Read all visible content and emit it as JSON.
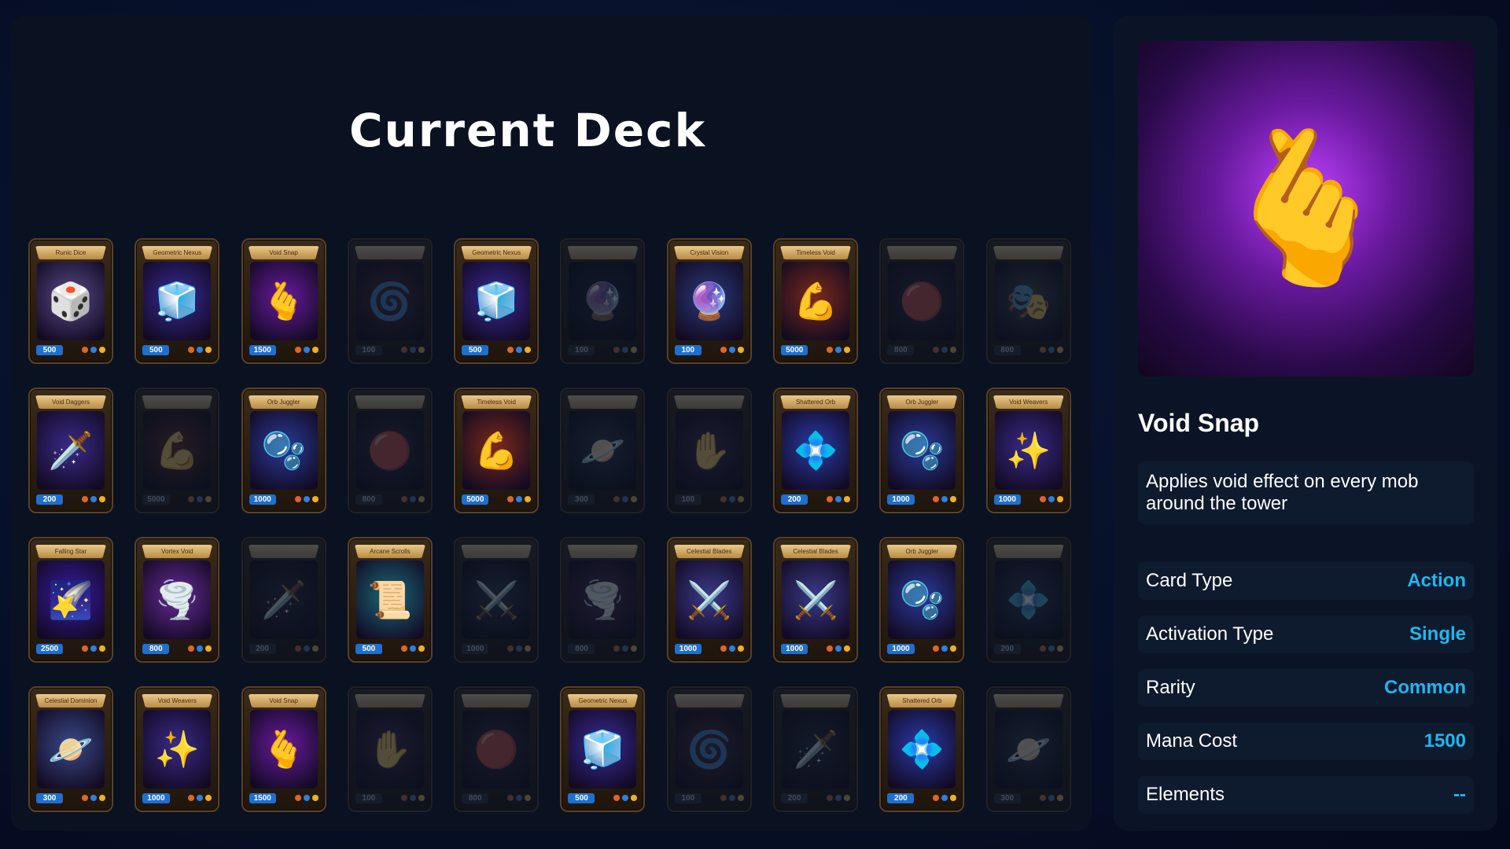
{
  "deck": {
    "title": "Current Deck",
    "cards": [
      {
        "name": "Runic Dice",
        "cost": "500",
        "icon": "dice-icon",
        "glyph": "🎲",
        "bg": "#5a4a8a",
        "active": true
      },
      {
        "name": "Geometric Nexus",
        "cost": "500",
        "icon": "cube-icon",
        "glyph": "🧊",
        "bg": "#3a2a9a",
        "active": true
      },
      {
        "name": "Void Snap",
        "cost": "1500",
        "icon": "snap-hand-icon",
        "glyph": "🫰",
        "bg": "#6a1aa0",
        "active": true
      },
      {
        "name": "",
        "cost": "100",
        "icon": "spiral-icon",
        "glyph": "🌀",
        "bg": "#5a2a3a",
        "active": false
      },
      {
        "name": "Geometric Nexus",
        "cost": "500",
        "icon": "cube-icon",
        "glyph": "🧊",
        "bg": "#3a2a9a",
        "active": true
      },
      {
        "name": "",
        "cost": "100",
        "icon": "crystal-ball-icon",
        "glyph": "🔮",
        "bg": "#1a2a4a",
        "active": false
      },
      {
        "name": "Crystal Vision",
        "cost": "100",
        "icon": "crystal-ball-icon",
        "glyph": "🔮",
        "bg": "#2a3a7a",
        "active": true
      },
      {
        "name": "Timeless Void",
        "cost": "5000",
        "icon": "muscle-arm-icon",
        "glyph": "💪",
        "bg": "#7a2a1a",
        "active": true
      },
      {
        "name": "",
        "cost": "800",
        "icon": "orb-hand-icon",
        "glyph": "🔴",
        "bg": "#3a2a4a",
        "active": false
      },
      {
        "name": "",
        "cost": "800",
        "icon": "mask-icon",
        "glyph": "🎭",
        "bg": "#4a4a5a",
        "active": false
      },
      {
        "name": "Void Daggers",
        "cost": "200",
        "icon": "daggers-icon",
        "glyph": "🗡️",
        "bg": "#3a2a8a",
        "active": true
      },
      {
        "name": "",
        "cost": "5000",
        "icon": "muscle-arm-icon",
        "glyph": "💪",
        "bg": "#7a2a1a",
        "active": false
      },
      {
        "name": "Orb Juggler",
        "cost": "1000",
        "icon": "orbs-icon",
        "glyph": "🫧",
        "bg": "#2a3a9a",
        "active": true
      },
      {
        "name": "",
        "cost": "800",
        "icon": "orb-hand-icon",
        "glyph": "🔴",
        "bg": "#3a2a4a",
        "active": false
      },
      {
        "name": "Timeless Void",
        "cost": "5000",
        "icon": "muscle-arm-icon",
        "glyph": "💪",
        "bg": "#7a2a1a",
        "active": true
      },
      {
        "name": "",
        "cost": "300",
        "icon": "planet-icon",
        "glyph": "🪐",
        "bg": "#2a3a5a",
        "active": false
      },
      {
        "name": "",
        "cost": "100",
        "icon": "hand-icon",
        "glyph": "✋",
        "bg": "#4a2a5a",
        "active": false
      },
      {
        "name": "Shattered Orb",
        "cost": "200",
        "icon": "shattered-orb-icon",
        "glyph": "💠",
        "bg": "#2a3aaa",
        "active": true
      },
      {
        "name": "Orb Juggler",
        "cost": "1000",
        "icon": "orbs-icon",
        "glyph": "🫧",
        "bg": "#2a3a9a",
        "active": true
      },
      {
        "name": "Void Weavers",
        "cost": "1000",
        "icon": "magic-hand-icon",
        "glyph": "✨",
        "bg": "#3a2a8a",
        "active": true
      },
      {
        "name": "Falling Star",
        "cost": "2500",
        "icon": "falling-star-icon",
        "glyph": "🌠",
        "bg": "#3a1aaa",
        "active": true
      },
      {
        "name": "Vortex Void",
        "cost": "800",
        "icon": "vortex-icon",
        "glyph": "🌪️",
        "bg": "#6a2a9a",
        "active": true
      },
      {
        "name": "",
        "cost": "200",
        "icon": "daggers-icon",
        "glyph": "🗡️",
        "bg": "#2a2a4a",
        "active": false
      },
      {
        "name": "Arcane Scrolls",
        "cost": "500",
        "icon": "scrolls-icon",
        "glyph": "📜",
        "bg": "#1a6a7a",
        "active": true
      },
      {
        "name": "",
        "cost": "1000",
        "icon": "blades-icon",
        "glyph": "⚔️",
        "bg": "#2a3a5a",
        "active": false
      },
      {
        "name": "",
        "cost": "800",
        "icon": "vortex-icon",
        "glyph": "🌪️",
        "bg": "#5a2a6a",
        "active": false
      },
      {
        "name": "Celestial Blades",
        "cost": "1000",
        "icon": "blades-icon",
        "glyph": "⚔️",
        "bg": "#3a3a8a",
        "active": true
      },
      {
        "name": "Celestial Blades",
        "cost": "1000",
        "icon": "blades-icon",
        "glyph": "⚔️",
        "bg": "#3a3a8a",
        "active": true
      },
      {
        "name": "Orb Juggler",
        "cost": "1000",
        "icon": "orbs-icon",
        "glyph": "🫧",
        "bg": "#2a3a9a",
        "active": true
      },
      {
        "name": "",
        "cost": "200",
        "icon": "shattered-orb-icon",
        "glyph": "💠",
        "bg": "#2a3a6a",
        "active": false
      },
      {
        "name": "Celestial Dominion",
        "cost": "300",
        "icon": "planet-icon",
        "glyph": "🪐",
        "bg": "#3a4a8a",
        "active": true
      },
      {
        "name": "Void Weavers",
        "cost": "1000",
        "icon": "magic-hand-icon",
        "glyph": "✨",
        "bg": "#3a2a8a",
        "active": true
      },
      {
        "name": "Void Snap",
        "cost": "1500",
        "icon": "snap-hand-icon",
        "glyph": "🫰",
        "bg": "#6a1aa0",
        "active": true
      },
      {
        "name": "",
        "cost": "100",
        "icon": "hand-icon",
        "glyph": "✋",
        "bg": "#4a2a5a",
        "active": false
      },
      {
        "name": "",
        "cost": "800",
        "icon": "orb-hand-icon",
        "glyph": "🔴",
        "bg": "#3a2a4a",
        "active": false
      },
      {
        "name": "Geometric Nexus",
        "cost": "500",
        "icon": "cube-icon",
        "glyph": "🧊",
        "bg": "#3a2a9a",
        "active": true
      },
      {
        "name": "",
        "cost": "100",
        "icon": "spiral-icon",
        "glyph": "🌀",
        "bg": "#5a2a3a",
        "active": false
      },
      {
        "name": "",
        "cost": "200",
        "icon": "daggers-icon",
        "glyph": "🗡️",
        "bg": "#2a2a4a",
        "active": false
      },
      {
        "name": "Shattered Orb",
        "cost": "200",
        "icon": "shattered-orb-icon",
        "glyph": "💠",
        "bg": "#2a3aaa",
        "active": true
      },
      {
        "name": "",
        "cost": "300",
        "icon": "planet-icon",
        "glyph": "🪐",
        "bg": "#2a3a5a",
        "active": false
      }
    ]
  },
  "detail": {
    "art_icon": "snap-hand-icon",
    "art_glyph": "🫰",
    "name": "Void Snap",
    "description": "Applies void effect on every mob around the tower",
    "stats": [
      {
        "label": "Card Type",
        "value": "Action"
      },
      {
        "label": "Activation Type",
        "value": "Single"
      },
      {
        "label": "Rarity",
        "value": "Common"
      },
      {
        "label": "Mana Cost",
        "value": "1500"
      },
      {
        "label": "Elements",
        "value": "--"
      }
    ]
  },
  "colors": {
    "accent": "#1fb6f0",
    "cost_badge": "#1e6fd0",
    "element_fire": "#e0642a",
    "element_water": "#2c7fe0",
    "element_light": "#f0b020"
  }
}
